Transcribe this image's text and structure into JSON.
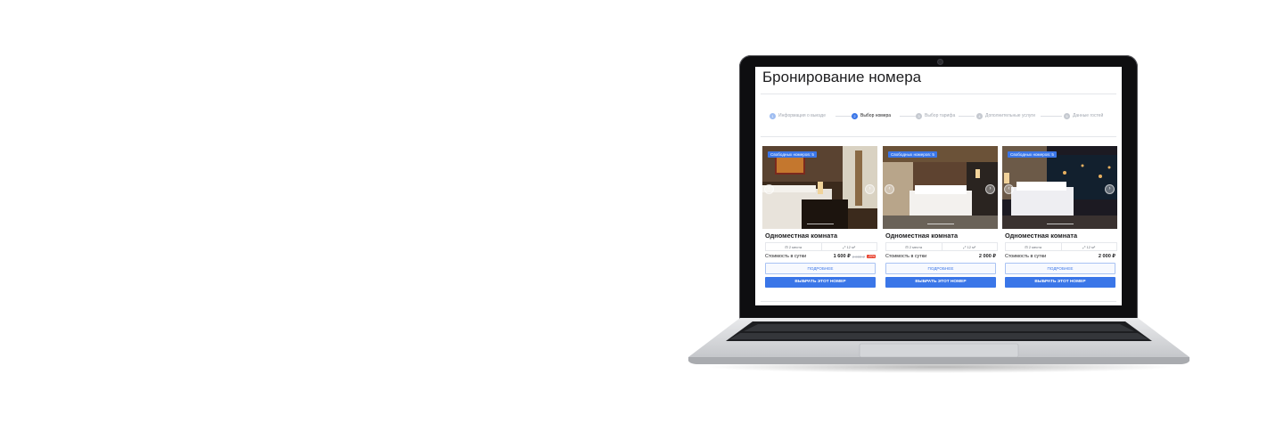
{
  "page": {
    "title": "Бронирование номера",
    "steps": [
      {
        "num": "1",
        "label": "Информация о выезде",
        "state": "done"
      },
      {
        "num": "2",
        "label": "Выбор номера",
        "state": "active"
      },
      {
        "num": "3",
        "label": "Выбор тарифа",
        "state": "todo"
      },
      {
        "num": "4",
        "label": "Дополнительные услуги",
        "state": "todo"
      },
      {
        "num": "5",
        "label": "Данные гостей",
        "state": "todo"
      }
    ],
    "colors": {
      "accent": "#3a76e8",
      "discount": "#e8432f"
    },
    "rooms": [
      {
        "badge": "Свободных номеров: 5",
        "name": "Одноместная комната",
        "guests": "2 места",
        "area": "12 м²",
        "price_label": "Стоимость в сутки",
        "price": "1 600 ₽",
        "old_price": "2 000 ₽",
        "discount": "-20%",
        "more_label": "ПОДРОБНЕЕ",
        "select_label": "ВЫБРАТЬ ЭТОТ НОМЕР"
      },
      {
        "badge": "Свободных номеров: 5",
        "name": "Одноместная комната",
        "guests": "2 места",
        "area": "12 м²",
        "price_label": "Стоимость в сутки",
        "price": "2 000 ₽",
        "more_label": "ПОДРОБНЕЕ",
        "select_label": "ВЫБРАТЬ ЭТОТ НОМЕР"
      },
      {
        "badge": "Свободных номеров: 5",
        "name": "Одноместная комната",
        "guests": "2 места",
        "area": "12 м²",
        "price_label": "Стоимость в сутки",
        "price": "2 000 ₽",
        "more_label": "ПОДРОБНЕЕ",
        "select_label": "ВЫБРАТЬ ЭТОТ НОМЕР"
      }
    ]
  }
}
